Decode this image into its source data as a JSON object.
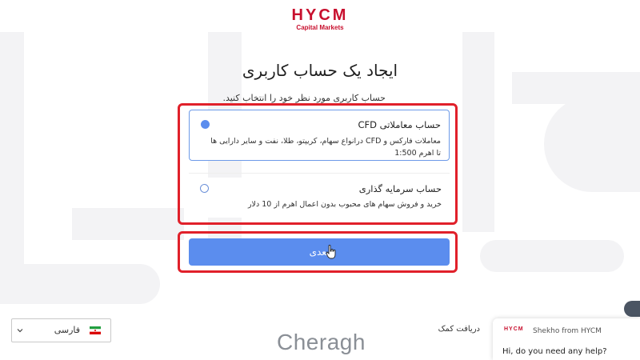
{
  "logo": {
    "main": "HYCM",
    "sub": "Capital Markets"
  },
  "title": "ایجاد یک حساب کاربری",
  "subtitle": "حساب کاربری مورد نظر خود را انتخاب کنید.",
  "accounts": [
    {
      "title": "حساب معاملاتی CFD",
      "description": "معاملات فارکس و CFD درانواع سهام، کریپتو، طلا، نفت و سایر دارایی ها تا اهرم 1:500",
      "selected": true
    },
    {
      "title": "حساب سرمایه گذاری",
      "description": "خرید و فروش سهام های محبوب بدون اعمال اهرم از 10 دلار",
      "selected": false
    }
  ],
  "next_button": "بعدی",
  "language": {
    "label": "فارسی",
    "flag_icon": "iran-flag-icon"
  },
  "help_link": "دریافت کمک",
  "watermark": "Cheragh",
  "chat": {
    "logo": "HYCM",
    "from": "Shekho from HYCM",
    "message": "Hi, do you need any help?"
  },
  "colors": {
    "brand": "#c8102e",
    "primary": "#5b8dee",
    "highlight": "#e0202a"
  }
}
